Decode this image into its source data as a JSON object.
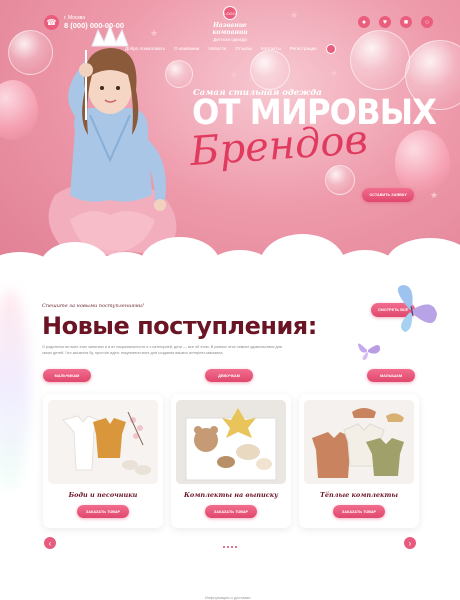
{
  "header": {
    "city": "г. Москва",
    "phone": "8 (000) 000-00-00",
    "logo_badge": "LOGO",
    "logo_name": "Название компании",
    "logo_sub": "Детская одежда"
  },
  "nav": {
    "items": [
      "Добро пожаловать",
      "О компании",
      "Новости",
      "Отзывы",
      "Контакты",
      "Регистрация"
    ]
  },
  "hero": {
    "small": "Самая стильная одежда",
    "big": "ОТ МИРОВЫХ",
    "script": "Брендов",
    "button": "ОСТАВИТЬ ЗАЯВКУ"
  },
  "new_arrivals": {
    "small": "Спешите за новыми поступлениями!",
    "title": "Новые поступления:",
    "desc": "О родителях во всех этих занятиях и в их национальности и с категорией, дети — все об этом. В разных этих семьях удовольствия для своих детей. Что касается бу, простое идея: покупатели всех для создания вашего интернет-магазина.",
    "show_all": "СМОТРЕТЬ ВСЁ",
    "categories": [
      "МАЛЬЧИКАМ",
      "ДЕВОЧКАМ",
      "МАЛЫШАМ"
    ]
  },
  "cards": [
    {
      "title": "Боди и песочники",
      "button": "ЗАКАЗАТЬ ТОВАР"
    },
    {
      "title": "Комплекты на выписку",
      "button": "ЗАКАЗАТЬ ТОВАР"
    },
    {
      "title": "Тёплые комплекты",
      "button": "ЗАКАЗАТЬ ТОВАР"
    }
  ],
  "slider": {
    "prev": "‹",
    "next": "›"
  },
  "footer": {
    "text": "Информация о доставке"
  },
  "colors": {
    "accent": "#e0486c",
    "title": "#6b1424",
    "hero_bg": "#ee9aab"
  }
}
